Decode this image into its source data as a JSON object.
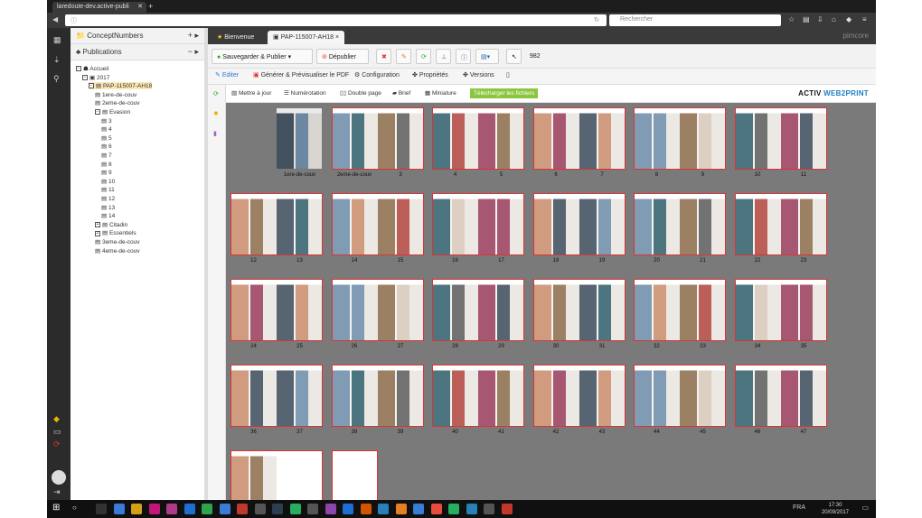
{
  "browser": {
    "tab_title": "laredoute-dev.active-publi",
    "url_text": "",
    "search_placeholder": "Rechercher"
  },
  "sidebar": {
    "tree_title": "ConceptNumbers",
    "pub_title": "Publications",
    "nodes": [
      {
        "label": "Accueil",
        "level": 0
      },
      {
        "label": "2017",
        "level": 1
      },
      {
        "label": "PAP-115007-AH18",
        "level": 2,
        "selected": true
      },
      {
        "label": "1ere-de-couv",
        "level": 3
      },
      {
        "label": "2eme-de-couv",
        "level": 3
      },
      {
        "label": "Evasion",
        "level": 3
      },
      {
        "label": "3",
        "level": 4
      },
      {
        "label": "4",
        "level": 4
      },
      {
        "label": "5",
        "level": 4
      },
      {
        "label": "6",
        "level": 4
      },
      {
        "label": "7",
        "level": 4
      },
      {
        "label": "8",
        "level": 4
      },
      {
        "label": "9",
        "level": 4
      },
      {
        "label": "10",
        "level": 4
      },
      {
        "label": "11",
        "level": 4
      },
      {
        "label": "12",
        "level": 4
      },
      {
        "label": "13",
        "level": 4
      },
      {
        "label": "14",
        "level": 4
      },
      {
        "label": "Citadin",
        "level": 3
      },
      {
        "label": "Essentiels",
        "level": 3
      },
      {
        "label": "3eme-de-couv",
        "level": 3
      },
      {
        "label": "4eme-de-couv",
        "level": 3
      }
    ]
  },
  "main": {
    "tabs": [
      "Bienvenue",
      "PAP-115007-AH18"
    ],
    "brand": "pimcore",
    "toolbar": {
      "save": "Sauvegarder & Publier",
      "unpublish": "Dépublier",
      "id": "982"
    },
    "subtabs": [
      "Editer",
      "Générer & Prévisualiser le PDF",
      "Configuration",
      "Propriétés",
      "Versions"
    ],
    "actions": [
      "Mettre à jour",
      "Numérotation",
      "Double page",
      "Brief",
      "Miniature"
    ],
    "download": "Télécharger les fichiers",
    "logo_a": "ACTIV",
    "logo_b": "WEB2PRINT"
  },
  "spreads": [
    [
      "",
      "1ere-de-couv"
    ],
    [
      "2eme-de-couv",
      "3"
    ],
    [
      "4",
      "5"
    ],
    [
      "6",
      "7"
    ],
    [
      "8",
      "9"
    ],
    [
      "10",
      "11"
    ],
    [
      "12",
      "13"
    ],
    [
      "14",
      "15"
    ],
    [
      "16",
      "17"
    ],
    [
      "18",
      "19"
    ],
    [
      "20",
      "21"
    ],
    [
      "22",
      "23"
    ],
    [
      "24",
      "25"
    ],
    [
      "26",
      "27"
    ],
    [
      "28",
      "29"
    ],
    [
      "30",
      "31"
    ],
    [
      "32",
      "33"
    ],
    [
      "34",
      "35"
    ],
    [
      "36",
      "37"
    ],
    [
      "38",
      "39"
    ],
    [
      "40",
      "41"
    ],
    [
      "42",
      "43"
    ],
    [
      "44",
      "45"
    ],
    [
      "46",
      "47"
    ],
    [
      "",
      ""
    ],
    [
      "",
      ""
    ]
  ],
  "taskbar": {
    "lang": "FRA",
    "time": "17:30",
    "date": "20/09/2017"
  }
}
